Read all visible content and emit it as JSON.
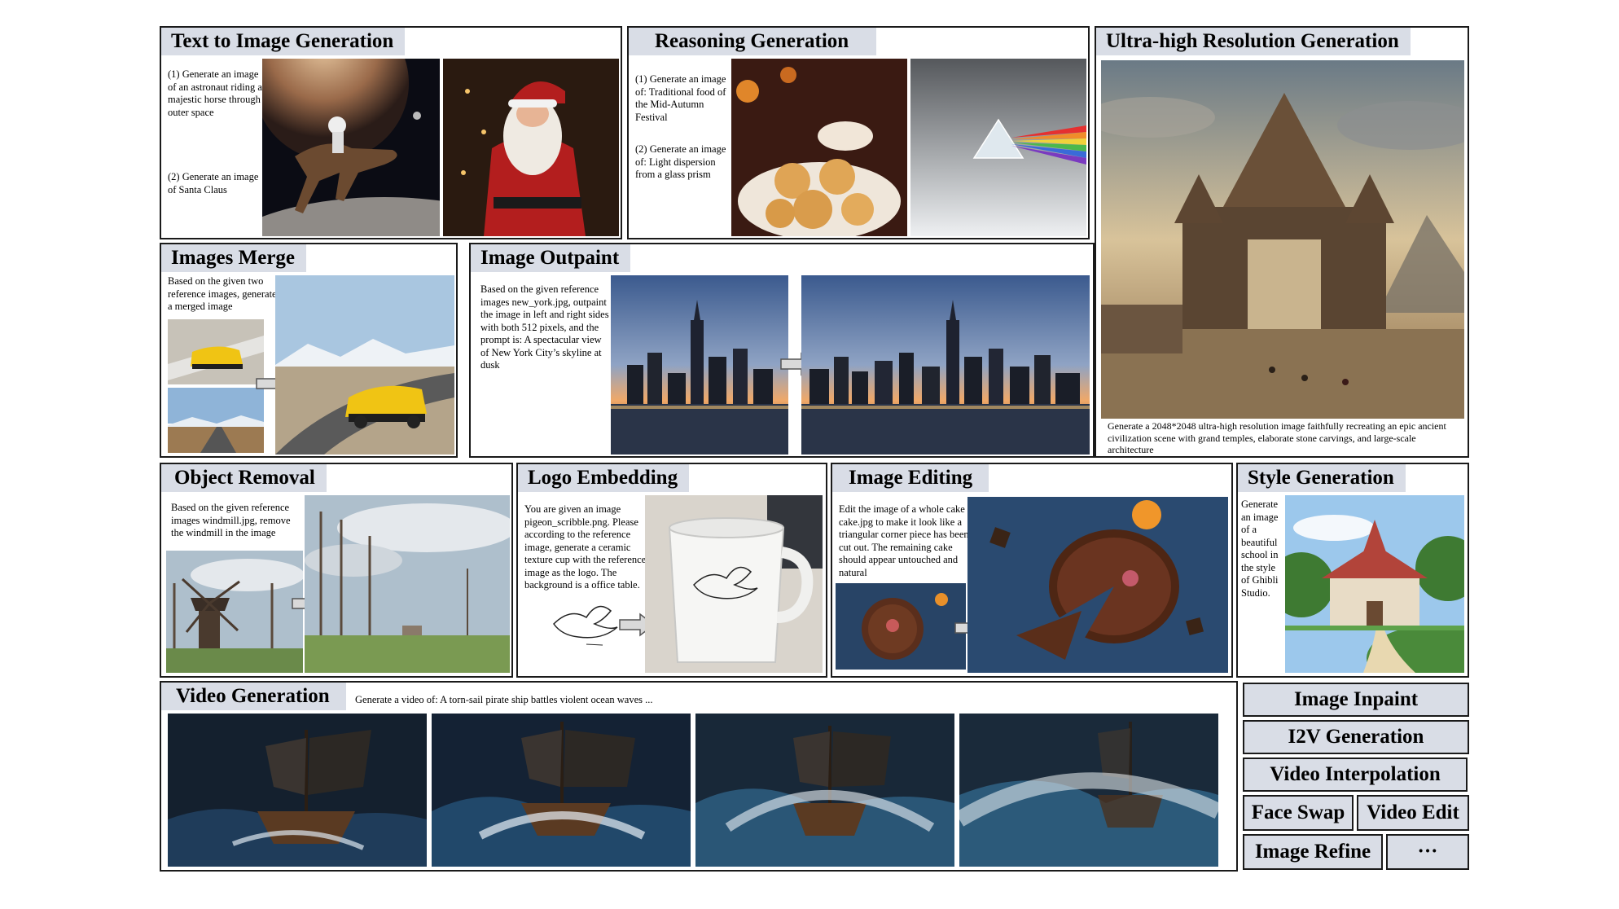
{
  "panels": {
    "t2i": {
      "title": "Text to Image Generation",
      "prompt1": "(1) Generate an image of an astronaut riding a majestic horse through outer space",
      "prompt2": "(2) Generate an image of Santa Claus"
    },
    "reasoning": {
      "title": "Reasoning Generation",
      "prompt1": "(1) Generate an image of: Traditional food of the Mid-Autumn Festival",
      "prompt2": "(2) Generate an image of: Light dispersion from a glass prism"
    },
    "ultra": {
      "title": "Ultra-high Resolution Generation",
      "caption": "Generate a 2048*2048 ultra-high resolution image faithfully recreating an epic ancient civilization scene with grand temples, elaborate stone carvings, and large-scale architecture"
    },
    "merge": {
      "title": "Images Merge",
      "prompt": "Based on the given two reference images, generate a merged image"
    },
    "outpaint": {
      "title": "Image Outpaint",
      "prompt": "Based on the given reference images new_york.jpg, outpaint the image in left and right sides with both 512 pixels, and the prompt is: A spectacular view of New York City’s skyline at dusk"
    },
    "removal": {
      "title": "Object Removal",
      "prompt": "Based on the given reference images windmill.jpg, remove the windmill in the image"
    },
    "logo": {
      "title": "Logo Embedding",
      "prompt": "You are given an image pigeon_scribble.png. Please according to the reference image, generate a ceramic texture cup with the reference image as the logo. The background is a office table."
    },
    "editing": {
      "title": "Image Editing",
      "prompt": "Edit the image of a whole cake cake.jpg to make it look like a triangular corner piece has been cut out. The remaining cake should appear untouched and natural"
    },
    "style": {
      "title": "Style Generation",
      "prompt": "Generate\nan image\nof a\nbeautiful\nschool in\nthe style\nof Ghibli\nStudio."
    },
    "video": {
      "title": "Video Generation",
      "prompt": "Generate a video of: A torn-sail pirate ship battles violent ocean waves ..."
    }
  },
  "features": {
    "inpaint": "Image Inpaint",
    "i2v": "I2V Generation",
    "interp": "Video Interpolation",
    "faceswap": "Face Swap",
    "videoedit": "Video Edit",
    "refine": "Image Refine",
    "more": "···"
  },
  "icons": {
    "arrow": "right-arrow-icon"
  },
  "colors": {
    "title_bg": "#d9dde6",
    "border": "#1a1a1a"
  }
}
